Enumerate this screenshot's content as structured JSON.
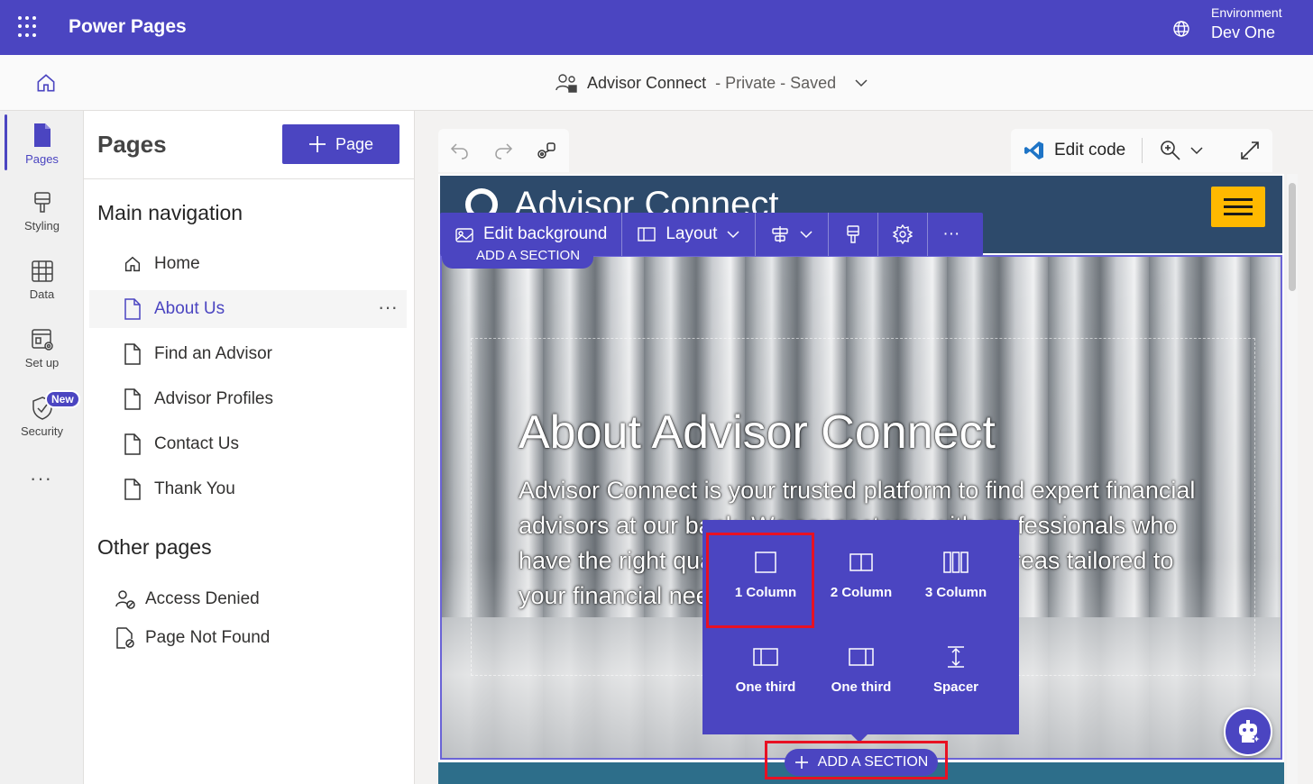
{
  "app": {
    "title": "Power Pages"
  },
  "environment": {
    "label": "Environment",
    "name": "Dev One"
  },
  "site": {
    "name": "Advisor Connect",
    "status": "- Private - Saved"
  },
  "rail": {
    "items": [
      {
        "label": "Pages",
        "icon": "page-icon"
      },
      {
        "label": "Styling",
        "icon": "brush-icon"
      },
      {
        "label": "Data",
        "icon": "table-icon"
      },
      {
        "label": "Set up",
        "icon": "setup-icon"
      },
      {
        "label": "Security",
        "icon": "shield-icon",
        "badge": "New"
      }
    ],
    "more": "···"
  },
  "pages_panel": {
    "title": "Pages",
    "add_label": "Page",
    "main_nav_heading": "Main navigation",
    "main_nav": [
      "Home",
      "About Us",
      "Find an Advisor",
      "Advisor Profiles",
      "Contact Us",
      "Thank You"
    ],
    "selected": "About Us",
    "other_heading": "Other pages",
    "other_pages": [
      "Access Denied",
      "Page Not Found"
    ]
  },
  "editor_toolbar": {
    "edit_code": "Edit code"
  },
  "site_preview": {
    "brand": "Advisor Connect",
    "hero_title": "About Advisor Connect",
    "hero_text": "Advisor Connect is your trusted platform to find expert financial advisors at our bank. We connect you with professionals who have the right qualifications and expertise in areas tailored to your financial needs."
  },
  "section_toolbar": {
    "edit_background": "Edit background",
    "layout": "Layout",
    "more": "···",
    "add_section_top": "ADD A SECTION"
  },
  "layout_popup": {
    "options": [
      {
        "label": "1 Column",
        "icon": "one-column-icon"
      },
      {
        "label": "2 Column",
        "icon": "two-column-icon"
      },
      {
        "label": "3 Column",
        "icon": "three-column-icon"
      },
      {
        "label": "One third",
        "icon": "one-third-left-icon"
      },
      {
        "label": "One third",
        "icon": "one-third-right-icon"
      },
      {
        "label": "Spacer",
        "icon": "spacer-icon"
      }
    ],
    "highlighted": "1 Column"
  },
  "add_section": {
    "label": "ADD A SECTION"
  },
  "colors": {
    "brand": "#4b45c1",
    "highlight": "#e81123",
    "site_header": "#2d4a6b",
    "accent": "#ffb900"
  }
}
